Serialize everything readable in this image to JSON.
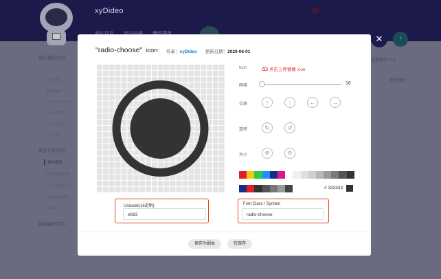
{
  "app": {
    "logo": "xyDideo",
    "nav_tabs": [
      "我的项目",
      "我的收藏",
      "我的项目"
    ],
    "sidebar_groups": [
      {
        "title": "我创建的项目",
        "items": [
          "IC",
          "新手项目",
          "我的项目",
          "oK_Noti_Icon",
          "oK_activity",
          "jFLA_图标",
          "FK_app"
        ]
      },
      {
        "title": "我参与的项目",
        "items": [
          "我的项目",
          "新项目图标组",
          "默认项目组二",
          "不快速到项目",
          "oKLE"
        ],
        "active_index": 0
      },
      {
        "title": "我收藏的项目",
        "items": []
      }
    ],
    "right_bg_text1": "批量操作 ∨ 3",
    "right_bg_text2": "查看删除"
  },
  "modal": {
    "icon_name_quoted": "\"radio-choose\"",
    "icon_word": "icon",
    "author_label": "作者：",
    "author": "xyDideo",
    "date_label": "更新日期：",
    "date": "2020-06-01",
    "controls": {
      "icon_label": "Icon",
      "upload_text": "点击上传替换 icon",
      "grid_label": "网格",
      "grid_value": "16",
      "position_label": "位移",
      "rotate_label": "旋转",
      "size_label": "大小"
    },
    "colors": {
      "row1": [
        "#e02020",
        "#f5c518",
        "#2ecc40",
        "#1e90ff",
        "#1b2a8a",
        "#d81b8a",
        "#ffffff",
        "#f0f0f0",
        "#e0e0e0",
        "#cfcfcf",
        "#b8b8b8",
        "#9a9a9a",
        "#7a7a7a",
        "#555555",
        "#333333"
      ],
      "row2": [
        "#1b2a8a",
        "#e02020",
        "#333333",
        "#555555",
        "#777777",
        "#999999",
        "#444444"
      ],
      "hex_prefix": "#",
      "hex_value": "333333",
      "current": "#333333"
    },
    "unicode_label": "Unicode(16进制)",
    "unicode_value": "e683",
    "font_class_label": "Font Class / Symbol",
    "font_class_value": "radio-choose",
    "save_copy_button": "保存为副本",
    "save_button": "仅保存"
  }
}
